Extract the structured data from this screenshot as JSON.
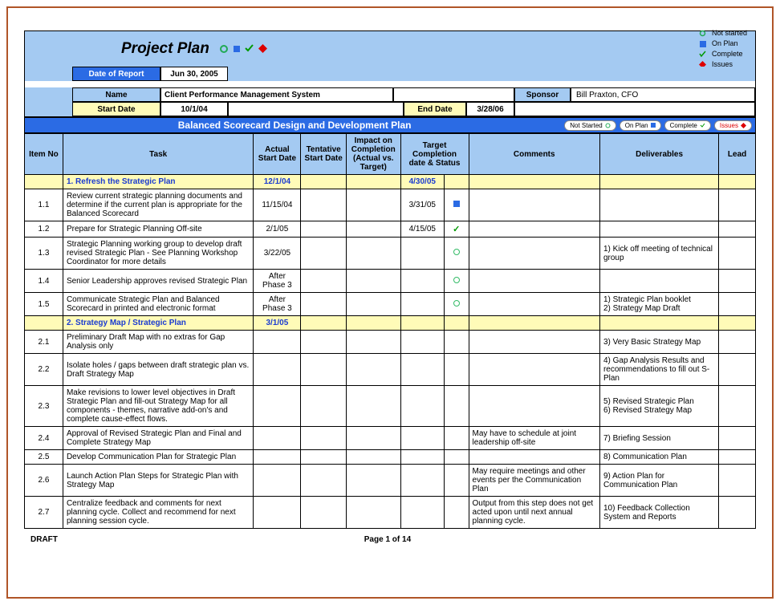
{
  "header": {
    "title": "Project Plan",
    "date_of_report_label": "Date of Report",
    "date_of_report": "Jun 30, 2005",
    "name_label": "Name",
    "name_value": "Client Performance Management System",
    "sponsor_label": "Sponsor",
    "sponsor_value": "Bill Praxton, CFO",
    "start_date_label": "Start Date",
    "start_date": "10/1/04",
    "end_date_label": "End Date",
    "end_date": "3/28/06"
  },
  "legend": {
    "not_started": "Not started",
    "on_plan": "On Plan",
    "complete": "Complete",
    "issues": "Issues"
  },
  "banner": {
    "title": "Balanced Scorecard Design and Development Plan",
    "btn_not_started": "Not Started",
    "btn_on_plan": "On Plan",
    "btn_complete": "Complete",
    "btn_issues": "Issues"
  },
  "columns": {
    "item_no": "Item No",
    "task": "Task",
    "actual_start": "Actual Start Date",
    "tentative_start": "Tentative Start Date",
    "impact": "Impact on Completion (Actual vs. Target)",
    "target_completion": "Target Completion date & Status",
    "comments": "Comments",
    "deliverables": "Deliverables",
    "lead": "Lead"
  },
  "sections": [
    {
      "num": "1",
      "title": "1. Refresh the Strategic Plan",
      "actual_start": "12/1/04",
      "target": "4/30/05"
    },
    {
      "num": "2",
      "title": "2. Strategy Map / Strategic Plan",
      "actual_start": "3/1/05",
      "target": ""
    }
  ],
  "rows": [
    {
      "section": 0,
      "item": "1.1",
      "task": "Review current strategic planning documents and determine if the current plan is appropriate for the Balanced Scorecard",
      "actual_start": "11/15/04",
      "tentative_start": "",
      "impact": "",
      "target": "3/31/05",
      "status": "square",
      "comments": "",
      "deliverables": "",
      "lead": ""
    },
    {
      "section": 0,
      "item": "1.2",
      "task": "Prepare for Strategic Planning Off-site",
      "actual_start": "2/1/05",
      "tentative_start": "",
      "impact": "",
      "target": "4/15/05",
      "status": "check",
      "comments": "",
      "deliverables": "",
      "lead": ""
    },
    {
      "section": 0,
      "item": "1.3",
      "task": "Strategic Planning working group to develop draft revised Strategic Plan - See Planning Workshop Coordinator for more details",
      "actual_start": "3/22/05",
      "tentative_start": "",
      "impact": "",
      "target": "",
      "status": "dot",
      "comments": "",
      "deliverables": "1) Kick off meeting of technical group",
      "lead": ""
    },
    {
      "section": 0,
      "item": "1.4",
      "task": "Senior Leadership approves revised Strategic Plan",
      "actual_start": "After Phase 3",
      "tentative_start": "",
      "impact": "",
      "target": "",
      "status": "dot",
      "comments": "",
      "deliverables": "",
      "lead": ""
    },
    {
      "section": 0,
      "item": "1.5",
      "task": "Communicate Strategic Plan and Balanced Scorecard in printed and electronic format",
      "actual_start": "After Phase 3",
      "tentative_start": "",
      "impact": "",
      "target": "",
      "status": "dot",
      "comments": "",
      "deliverables": "1) Strategic Plan booklet\n2) Strategy Map Draft",
      "lead": ""
    },
    {
      "section": 1,
      "item": "2.1",
      "task": "Preliminary Draft Map with no extras for Gap Analysis only",
      "actual_start": "",
      "tentative_start": "",
      "impact": "",
      "target": "",
      "status": "",
      "comments": "",
      "deliverables": "3) Very Basic Strategy Map",
      "lead": ""
    },
    {
      "section": 1,
      "item": "2.2",
      "task": "Isolate holes / gaps between draft strategic plan vs. Draft Strategy Map",
      "actual_start": "",
      "tentative_start": "",
      "impact": "",
      "target": "",
      "status": "",
      "comments": "",
      "deliverables": "4) Gap Analysis Results and recommendations to fill out S-Plan",
      "lead": ""
    },
    {
      "section": 1,
      "item": "2.3",
      "task": "Make revisions to lower level objectives in Draft Strategic Plan and fill-out Strategy Map for all components - themes, narrative add-on's and complete cause-effect flows.",
      "actual_start": "",
      "tentative_start": "",
      "impact": "",
      "target": "",
      "status": "",
      "comments": "",
      "deliverables": "5) Revised Strategic Plan\n6) Revised Strategy Map",
      "lead": ""
    },
    {
      "section": 1,
      "item": "2.4",
      "task": "Approval of Revised Strategic Plan and Final and Complete Strategy Map",
      "actual_start": "",
      "tentative_start": "",
      "impact": "",
      "target": "",
      "status": "",
      "comments": "May have to schedule at joint leadership off-site",
      "deliverables": "7) Briefing Session",
      "lead": ""
    },
    {
      "section": 1,
      "item": "2.5",
      "task": "Develop Communication Plan for Strategic Plan",
      "actual_start": "",
      "tentative_start": "",
      "impact": "",
      "target": "",
      "status": "",
      "comments": "",
      "deliverables": "8) Communication Plan",
      "lead": ""
    },
    {
      "section": 1,
      "item": "2.6",
      "task": "Launch Action Plan Steps for Strategic Plan with Strategy Map",
      "actual_start": "",
      "tentative_start": "",
      "impact": "",
      "target": "",
      "status": "",
      "comments": "May require meetings and other events per the Communication Plan",
      "deliverables": "9) Action Plan for Communication Plan",
      "lead": ""
    },
    {
      "section": 1,
      "item": "2.7",
      "task": "Centralize feedback and comments for next planning cycle. Collect and recommend for next planning session cycle.",
      "actual_start": "",
      "tentative_start": "",
      "impact": "",
      "target": "",
      "status": "",
      "comments": "Output from this step does not get acted upon until next annual planning cycle.",
      "deliverables": "10) Feedback Collection System and Reports",
      "lead": ""
    }
  ],
  "footer": {
    "draft": "DRAFT",
    "page": "Page 1 of 14"
  }
}
